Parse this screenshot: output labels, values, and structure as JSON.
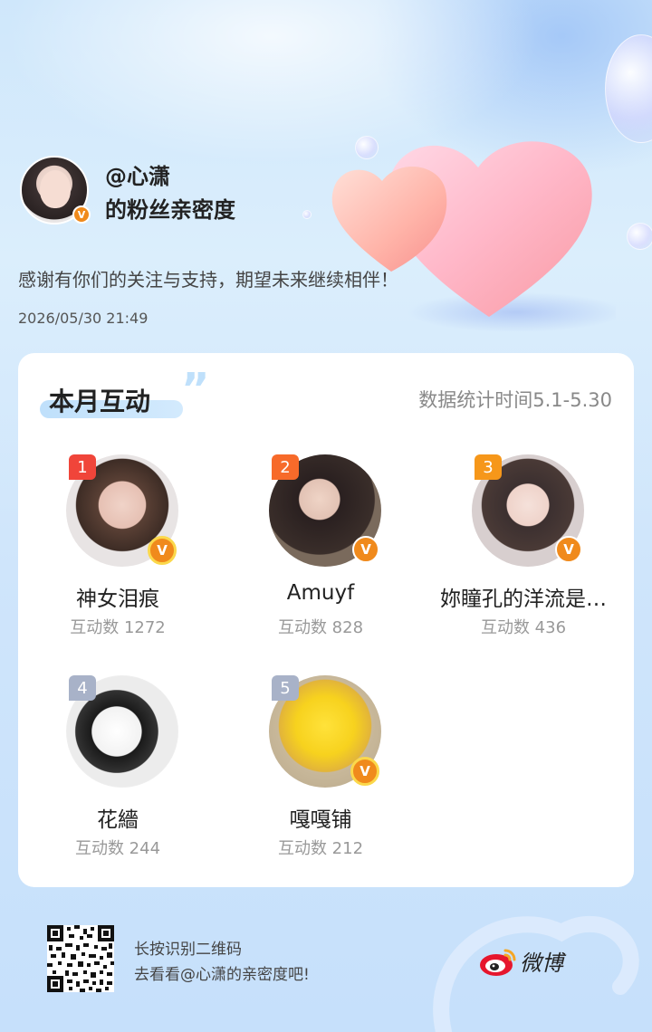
{
  "header": {
    "username": "@心潇",
    "subtitle": "的粉丝亲密度",
    "thanks": "感谢有你们的关注与支持，期望未来继续相伴！",
    "timestamp": "2026/05/30  21:49",
    "verified_badge": "V"
  },
  "card": {
    "title": "本月互动",
    "stat_period": "数据统计时间5.1-5.30",
    "fans": [
      {
        "rank": "1",
        "name": "神女泪痕",
        "count": "互动数 1272",
        "badge_color": "#f0453a",
        "verified": "V"
      },
      {
        "rank": "2",
        "name": "Amuyf",
        "count": "互动数 828",
        "badge_color": "#f76a2a",
        "verified": "V"
      },
      {
        "rank": "3",
        "name": "妳瞳孔的洋流是…",
        "count": "互动数 436",
        "badge_color": "#f6971a",
        "verified": "V"
      },
      {
        "rank": "4",
        "name": "花繬",
        "count": "互动数 244",
        "badge_color": "#a8b2c8",
        "verified": ""
      },
      {
        "rank": "5",
        "name": "嘎嘎铺",
        "count": "互动数 212",
        "badge_color": "#a8b2c8",
        "verified": "V"
      }
    ]
  },
  "footer": {
    "qr_line1": "长按识别二维码",
    "qr_line2": "去看看@心潇的亲密度吧!",
    "brand": "微博"
  },
  "icons": {
    "qr": "qr-code-icon",
    "weibo": "weibo-logo-icon",
    "verified": "verified-v-icon"
  },
  "colors": {
    "verified_orange": "#f08a1c",
    "card_bg": "#ffffff",
    "accent_blue": "#bfe0fb"
  }
}
